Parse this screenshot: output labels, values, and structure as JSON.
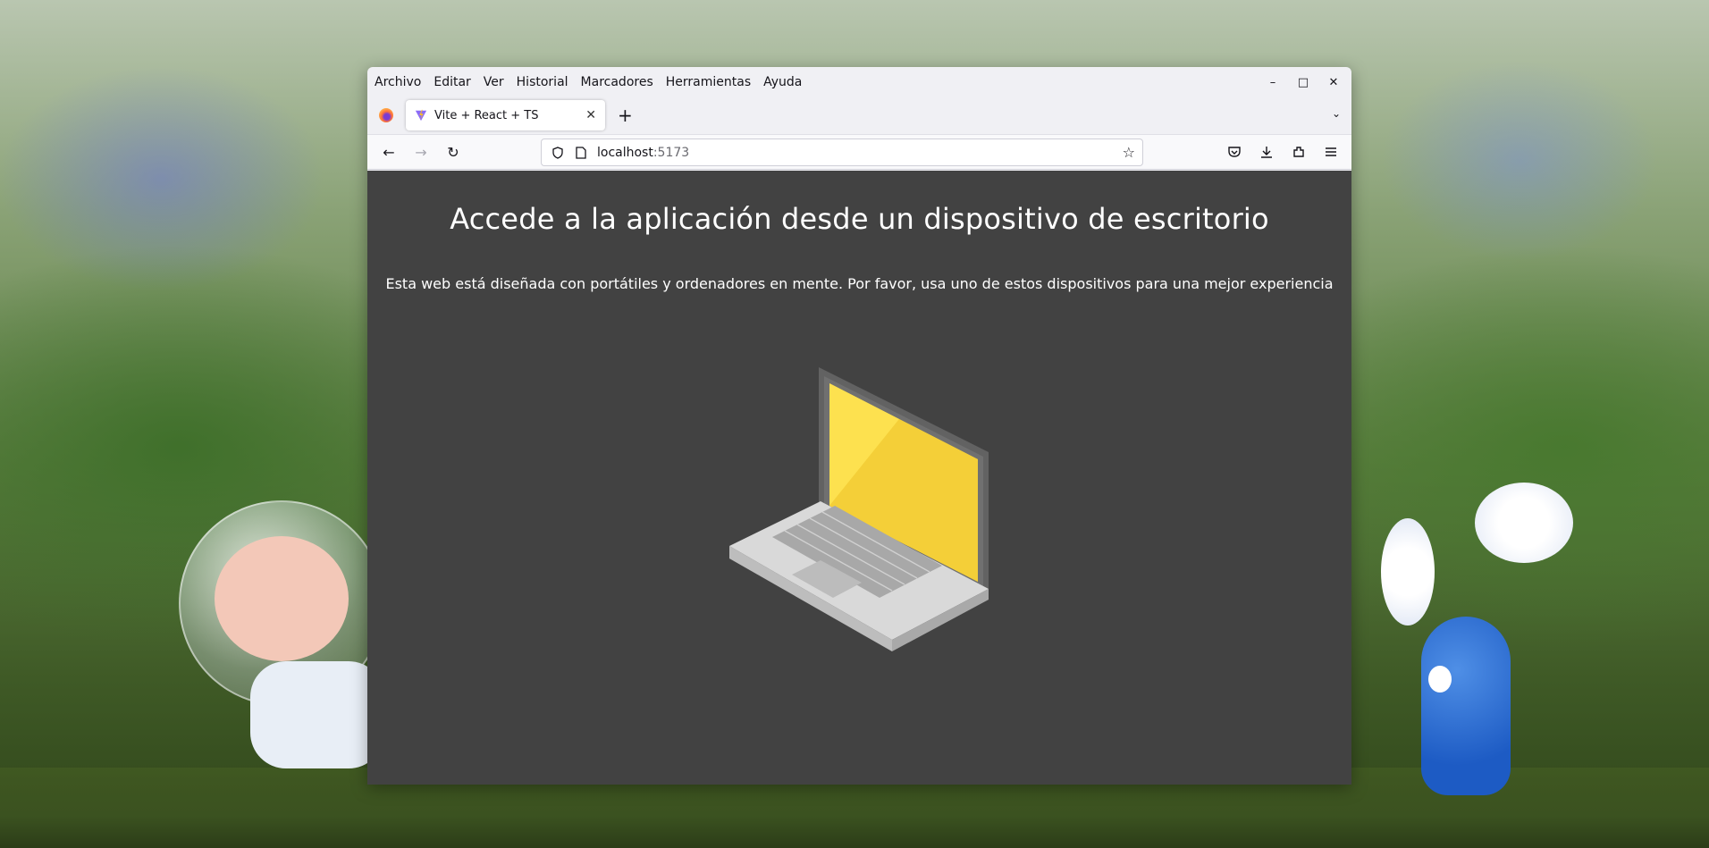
{
  "menubar": {
    "items": [
      "Archivo",
      "Editar",
      "Ver",
      "Historial",
      "Marcadores",
      "Herramientas",
      "Ayuda"
    ]
  },
  "window_controls": {
    "minimize": "–",
    "maximize": "□",
    "close": "✕"
  },
  "tabs": [
    {
      "title": "Vite + React + TS",
      "icon": "vite-icon",
      "active": true
    }
  ],
  "tabbar": {
    "new_tab": "+",
    "list_all": "⌄"
  },
  "navigation": {
    "back": "←",
    "forward": "→",
    "reload": "↻"
  },
  "urlbar": {
    "host": "localhost",
    "port": ":5173",
    "bookmark_star": "☆"
  },
  "toolbar_icons": [
    "pocket-icon",
    "downloads-icon",
    "extensions-icon",
    "menu-icon"
  ],
  "page": {
    "headline": "Accede a la aplicación desde un dispositivo de escritorio",
    "subtext": "Esta web está diseñada con portátiles y ordenadores en mente. Por favor, usa uno de estos dispositivos para una mejor experiencia",
    "illustration": "laptop-illustration",
    "background_color": "#424242",
    "screen_color": "#fbd842"
  }
}
